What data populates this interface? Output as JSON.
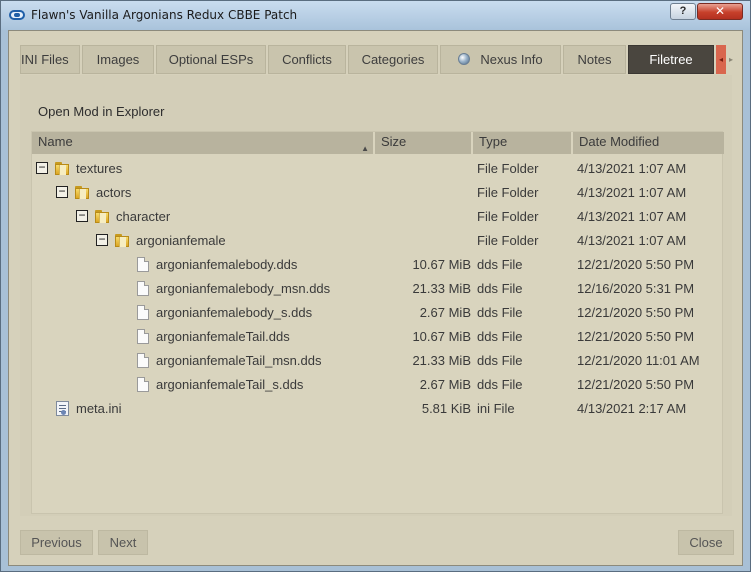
{
  "window": {
    "title": "Flawn's Vanilla Argonians Redux CBBE Patch",
    "help_label": "?",
    "close_label": "✕"
  },
  "tabs": [
    {
      "label": "INI Files"
    },
    {
      "label": "Images"
    },
    {
      "label": "Optional ESPs"
    },
    {
      "label": "Conflicts"
    },
    {
      "label": "Categories"
    },
    {
      "label": "Nexus Info",
      "icon": "globe-icon"
    },
    {
      "label": "Notes"
    },
    {
      "label": "Filetree",
      "active": true
    }
  ],
  "filetree": {
    "open_explorer_label": "Open Mod in Explorer",
    "columns": {
      "name": "Name",
      "size": "Size",
      "type": "Type",
      "date": "Date Modified"
    },
    "rows": [
      {
        "name": "textures",
        "size": "",
        "type": "File Folder",
        "date": "4/13/2021 1:07 AM",
        "kind": "folder",
        "depth": 0,
        "expander": "−"
      },
      {
        "name": "actors",
        "size": "",
        "type": "File Folder",
        "date": "4/13/2021 1:07 AM",
        "kind": "folder",
        "depth": 1,
        "expander": "−"
      },
      {
        "name": "character",
        "size": "",
        "type": "File Folder",
        "date": "4/13/2021 1:07 AM",
        "kind": "folder",
        "depth": 2,
        "expander": "−"
      },
      {
        "name": "argonianfemale",
        "size": "",
        "type": "File Folder",
        "date": "4/13/2021 1:07 AM",
        "kind": "folder",
        "depth": 3,
        "expander": "−"
      },
      {
        "name": "argonianfemalebody.dds",
        "size": "10.67 MiB",
        "type": "dds File",
        "date": "12/21/2020 5:50 PM",
        "kind": "file",
        "depth": 4
      },
      {
        "name": "argonianfemalebody_msn.dds",
        "size": "21.33 MiB",
        "type": "dds File",
        "date": "12/16/2020 5:31 PM",
        "kind": "file",
        "depth": 4
      },
      {
        "name": "argonianfemalebody_s.dds",
        "size": "2.67 MiB",
        "type": "dds File",
        "date": "12/21/2020 5:50 PM",
        "kind": "file",
        "depth": 4
      },
      {
        "name": "argonianfemaleTail.dds",
        "size": "10.67 MiB",
        "type": "dds File",
        "date": "12/21/2020 5:50 PM",
        "kind": "file",
        "depth": 4
      },
      {
        "name": "argonianfemaleTail_msn.dds",
        "size": "21.33 MiB",
        "type": "dds File",
        "date": "12/21/2020 11:01 AM",
        "kind": "file",
        "depth": 4
      },
      {
        "name": "argonianfemaleTail_s.dds",
        "size": "2.67 MiB",
        "type": "dds File",
        "date": "12/21/2020 5:50 PM",
        "kind": "file",
        "depth": 4
      },
      {
        "name": "meta.ini",
        "size": "5.81 KiB",
        "type": "ini File",
        "date": "4/13/2021 2:17 AM",
        "kind": "ini",
        "depth": 0
      }
    ]
  },
  "footer": {
    "previous_label": "Previous",
    "next_label": "Next",
    "close_label": "Close"
  }
}
